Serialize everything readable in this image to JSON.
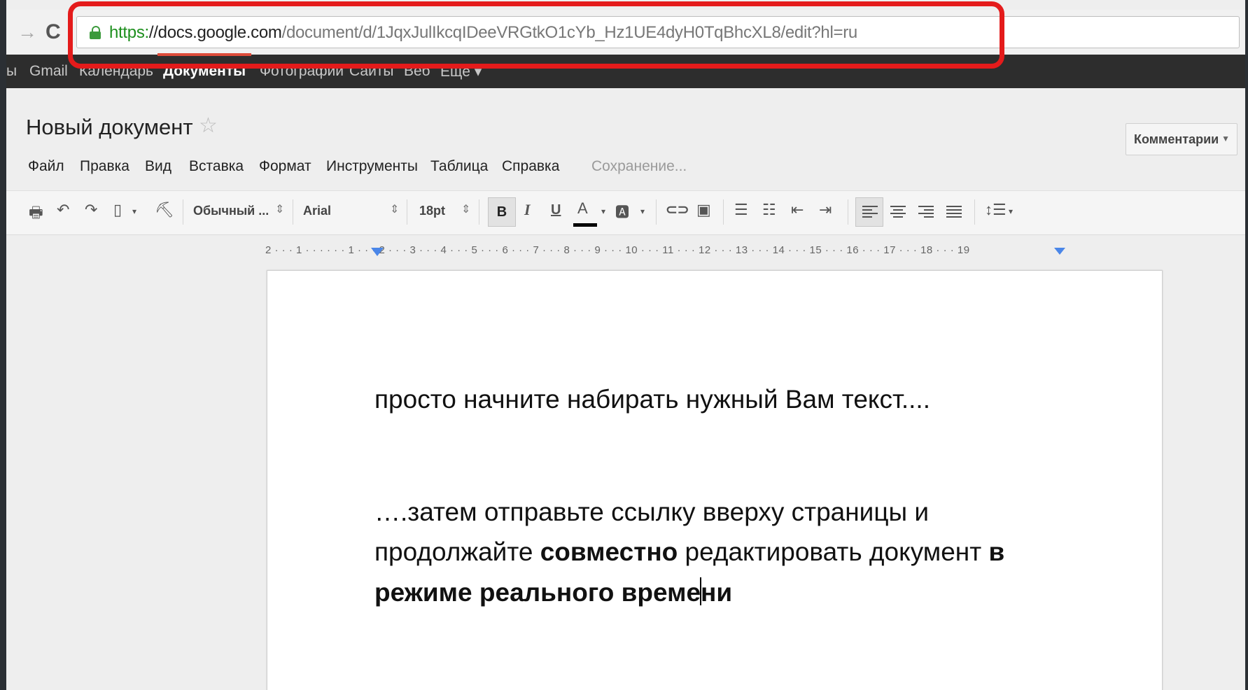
{
  "browser": {
    "url_scheme": "https:",
    "url_host": "//docs.google.com",
    "url_path": "/document/d/1JqxJulIkcqIDeeVRGtkO1cYb_Hz1UE4dyH0TqBhcXL8/edit?hl=ru",
    "highlight_color": "#e41b1b"
  },
  "google_bar": {
    "items": [
      "ы",
      "Gmail",
      "Календарь",
      "Документы",
      "Фотографии",
      "Сайты",
      "Веб",
      "Ещё ▾"
    ],
    "active_index": 3
  },
  "doc": {
    "title": "Новый документ",
    "comments_label": "Комментарии"
  },
  "menu": {
    "items": [
      "Файл",
      "Правка",
      "Вид",
      "Вставка",
      "Формат",
      "Инструменты",
      "Таблица",
      "Справка"
    ],
    "status": "Сохранение..."
  },
  "toolbar": {
    "style": "Обычный ...",
    "font": "Arial",
    "size": "18pt",
    "bold": "B",
    "italic": "I",
    "underline": "U",
    "text_color": "A"
  },
  "ruler": {
    "marks": "2 · · · 1 · · ·   · · · 1 · · · 2 · · · 3 · · · 4 · · · 5 · · · 6 · · · 7 · · · 8 · · · 9 · · · 10 · · · 11 · · · 12 · · · 13 · · · 14 · · · 15 · · · 16 · · · 17 · · · 18 · · · 19"
  },
  "body": {
    "para1": "просто начните набирать нужный Вам текст....",
    "para2_line1": "….затем отправьте ссылку вверху страницы и",
    "para2_line2_a": "продолжайте ",
    "para2_line2_b": "совместно",
    "para2_line2_c": " редактировать документ ",
    "para2_line2_d": "в",
    "para2_line3_a": "режиме реального време",
    "para2_line3_b": "ни"
  }
}
